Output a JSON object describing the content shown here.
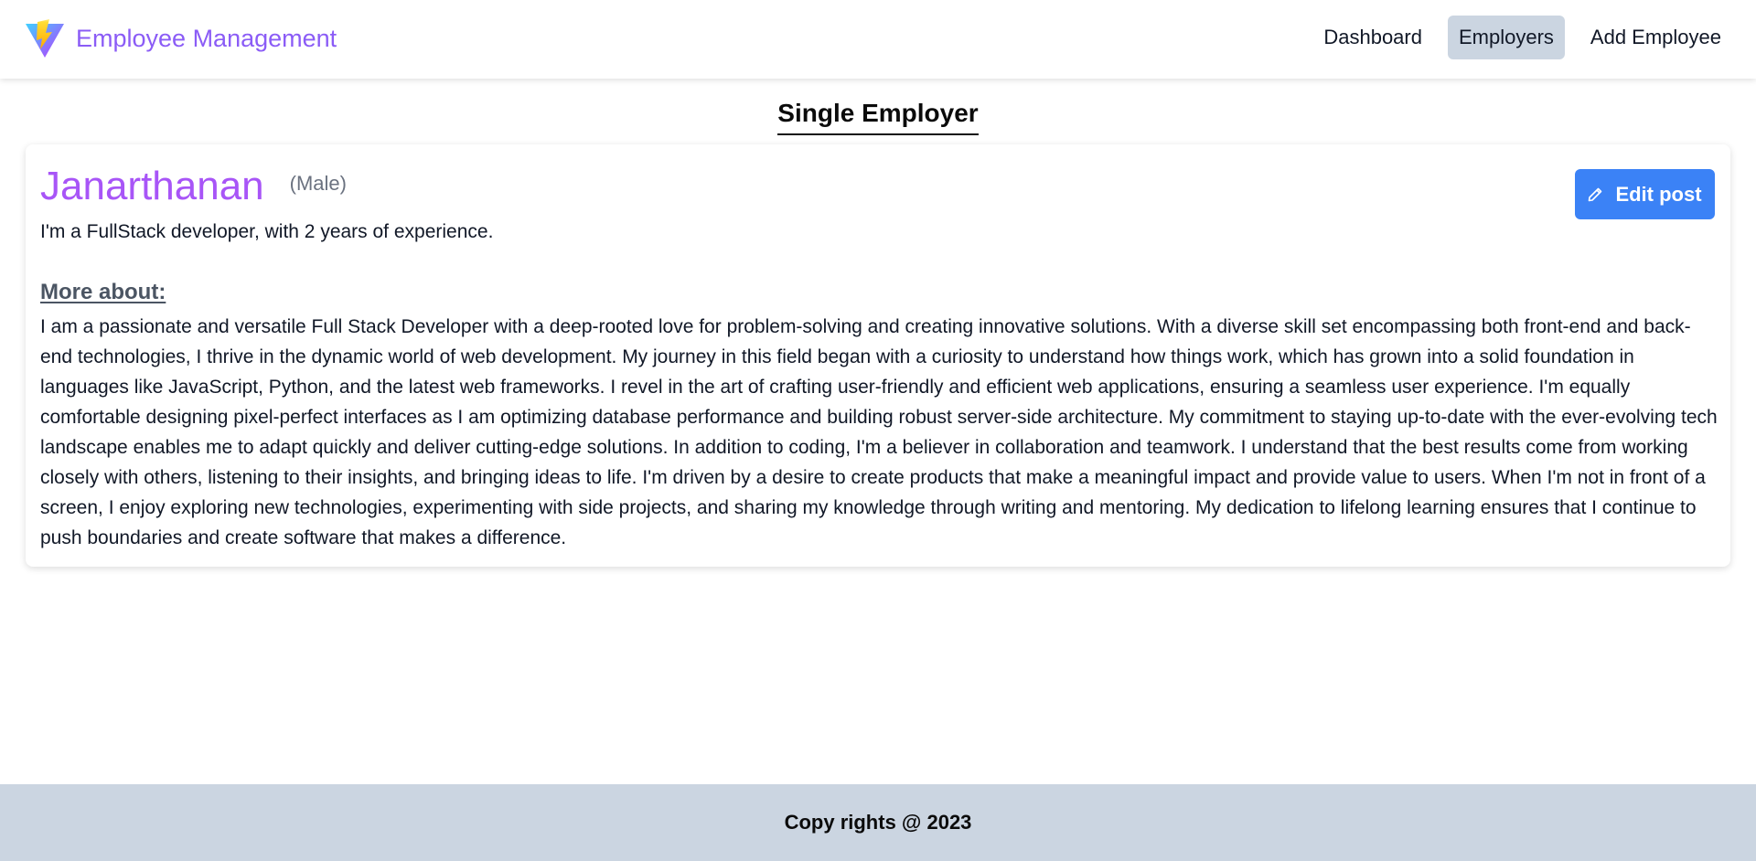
{
  "brand": {
    "title": "Employee Management",
    "logo_icon": "vite-logo-icon",
    "color": "#8b5cf6"
  },
  "nav": {
    "items": [
      {
        "label": "Dashboard",
        "active": false
      },
      {
        "label": "Employers",
        "active": true
      },
      {
        "label": "Add Employee",
        "active": false
      }
    ]
  },
  "page": {
    "heading": "Single Employer"
  },
  "employee": {
    "name": "Janarthanan",
    "gender": "(Male)",
    "short_bio": "I'm a FullStack developer, with 2 years of experience.",
    "more_title": "More about:",
    "more_text": "I am a passionate and versatile Full Stack Developer with a deep-rooted love for problem-solving and creating innovative solutions. With a diverse skill set encompassing both front-end and back-end technologies, I thrive in the dynamic world of web development. My journey in this field began with a curiosity to understand how things work, which has grown into a solid foundation in languages like JavaScript, Python, and the latest web frameworks. I revel in the art of crafting user-friendly and efficient web applications, ensuring a seamless user experience. I'm equally comfortable designing pixel-perfect interfaces as I am optimizing database performance and building robust server-side architecture. My commitment to staying up-to-date with the ever-evolving tech landscape enables me to adapt quickly and deliver cutting-edge solutions. In addition to coding, I'm a believer in collaboration and teamwork. I understand that the best results come from working closely with others, listening to their insights, and bringing ideas to life. I'm driven by a desire to create products that make a meaningful impact and provide value to users. When I'm not in front of a screen, I enjoy exploring new technologies, experimenting with side projects, and sharing my knowledge through writing and mentoring. My dedication to lifelong learning ensures that I continue to push boundaries and create software that makes a difference."
  },
  "actions": {
    "edit_label": "Edit post",
    "edit_icon": "pencil-icon",
    "edit_color": "#3b82f6"
  },
  "footer": {
    "text": "Copy rights @ 2023"
  },
  "colors": {
    "name": "#a855f7",
    "nav_active_bg": "#cbd5e1",
    "footer_bg": "#cbd5e1"
  }
}
